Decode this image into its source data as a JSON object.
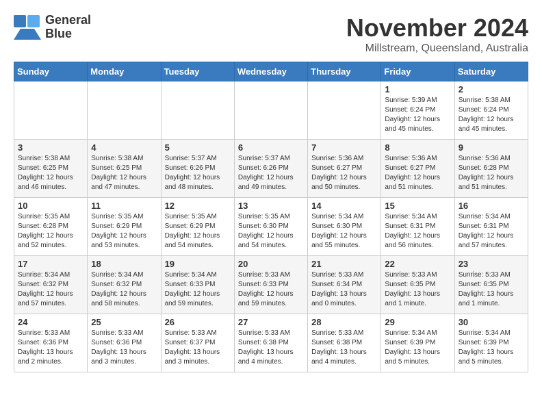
{
  "logo": {
    "name": "General",
    "name2": "Blue"
  },
  "title": "November 2024",
  "subtitle": "Millstream, Queensland, Australia",
  "days_of_week": [
    "Sunday",
    "Monday",
    "Tuesday",
    "Wednesday",
    "Thursday",
    "Friday",
    "Saturday"
  ],
  "weeks": [
    [
      {
        "day": "",
        "info": ""
      },
      {
        "day": "",
        "info": ""
      },
      {
        "day": "",
        "info": ""
      },
      {
        "day": "",
        "info": ""
      },
      {
        "day": "",
        "info": ""
      },
      {
        "day": "1",
        "info": "Sunrise: 5:39 AM\nSunset: 6:24 PM\nDaylight: 12 hours\nand 45 minutes."
      },
      {
        "day": "2",
        "info": "Sunrise: 5:38 AM\nSunset: 6:24 PM\nDaylight: 12 hours\nand 45 minutes."
      }
    ],
    [
      {
        "day": "3",
        "info": "Sunrise: 5:38 AM\nSunset: 6:25 PM\nDaylight: 12 hours\nand 46 minutes."
      },
      {
        "day": "4",
        "info": "Sunrise: 5:38 AM\nSunset: 6:25 PM\nDaylight: 12 hours\nand 47 minutes."
      },
      {
        "day": "5",
        "info": "Sunrise: 5:37 AM\nSunset: 6:26 PM\nDaylight: 12 hours\nand 48 minutes."
      },
      {
        "day": "6",
        "info": "Sunrise: 5:37 AM\nSunset: 6:26 PM\nDaylight: 12 hours\nand 49 minutes."
      },
      {
        "day": "7",
        "info": "Sunrise: 5:36 AM\nSunset: 6:27 PM\nDaylight: 12 hours\nand 50 minutes."
      },
      {
        "day": "8",
        "info": "Sunrise: 5:36 AM\nSunset: 6:27 PM\nDaylight: 12 hours\nand 51 minutes."
      },
      {
        "day": "9",
        "info": "Sunrise: 5:36 AM\nSunset: 6:28 PM\nDaylight: 12 hours\nand 51 minutes."
      }
    ],
    [
      {
        "day": "10",
        "info": "Sunrise: 5:35 AM\nSunset: 6:28 PM\nDaylight: 12 hours\nand 52 minutes."
      },
      {
        "day": "11",
        "info": "Sunrise: 5:35 AM\nSunset: 6:29 PM\nDaylight: 12 hours\nand 53 minutes."
      },
      {
        "day": "12",
        "info": "Sunrise: 5:35 AM\nSunset: 6:29 PM\nDaylight: 12 hours\nand 54 minutes."
      },
      {
        "day": "13",
        "info": "Sunrise: 5:35 AM\nSunset: 6:30 PM\nDaylight: 12 hours\nand 54 minutes."
      },
      {
        "day": "14",
        "info": "Sunrise: 5:34 AM\nSunset: 6:30 PM\nDaylight: 12 hours\nand 55 minutes."
      },
      {
        "day": "15",
        "info": "Sunrise: 5:34 AM\nSunset: 6:31 PM\nDaylight: 12 hours\nand 56 minutes."
      },
      {
        "day": "16",
        "info": "Sunrise: 5:34 AM\nSunset: 6:31 PM\nDaylight: 12 hours\nand 57 minutes."
      }
    ],
    [
      {
        "day": "17",
        "info": "Sunrise: 5:34 AM\nSunset: 6:32 PM\nDaylight: 12 hours\nand 57 minutes."
      },
      {
        "day": "18",
        "info": "Sunrise: 5:34 AM\nSunset: 6:32 PM\nDaylight: 12 hours\nand 58 minutes."
      },
      {
        "day": "19",
        "info": "Sunrise: 5:34 AM\nSunset: 6:33 PM\nDaylight: 12 hours\nand 59 minutes."
      },
      {
        "day": "20",
        "info": "Sunrise: 5:33 AM\nSunset: 6:33 PM\nDaylight: 12 hours\nand 59 minutes."
      },
      {
        "day": "21",
        "info": "Sunrise: 5:33 AM\nSunset: 6:34 PM\nDaylight: 13 hours\nand 0 minutes."
      },
      {
        "day": "22",
        "info": "Sunrise: 5:33 AM\nSunset: 6:35 PM\nDaylight: 13 hours\nand 1 minute."
      },
      {
        "day": "23",
        "info": "Sunrise: 5:33 AM\nSunset: 6:35 PM\nDaylight: 13 hours\nand 1 minute."
      }
    ],
    [
      {
        "day": "24",
        "info": "Sunrise: 5:33 AM\nSunset: 6:36 PM\nDaylight: 13 hours\nand 2 minutes."
      },
      {
        "day": "25",
        "info": "Sunrise: 5:33 AM\nSunset: 6:36 PM\nDaylight: 13 hours\nand 3 minutes."
      },
      {
        "day": "26",
        "info": "Sunrise: 5:33 AM\nSunset: 6:37 PM\nDaylight: 13 hours\nand 3 minutes."
      },
      {
        "day": "27",
        "info": "Sunrise: 5:33 AM\nSunset: 6:38 PM\nDaylight: 13 hours\nand 4 minutes."
      },
      {
        "day": "28",
        "info": "Sunrise: 5:33 AM\nSunset: 6:38 PM\nDaylight: 13 hours\nand 4 minutes."
      },
      {
        "day": "29",
        "info": "Sunrise: 5:34 AM\nSunset: 6:39 PM\nDaylight: 13 hours\nand 5 minutes."
      },
      {
        "day": "30",
        "info": "Sunrise: 5:34 AM\nSunset: 6:39 PM\nDaylight: 13 hours\nand 5 minutes."
      }
    ]
  ]
}
